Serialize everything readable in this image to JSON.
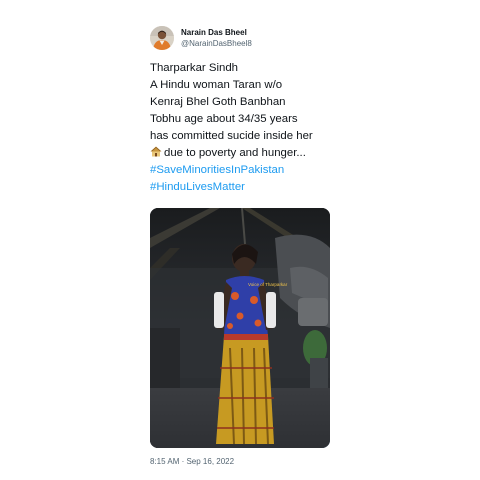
{
  "author": {
    "display_name": "Narain Das Bheel",
    "handle": "@NarainDasBheel8",
    "avatar_icon": "profile-photo-avatar"
  },
  "tweet": {
    "lines": [
      "Tharparkar Sindh",
      "A Hindu woman Taran w/o",
      "Kenraj Bhel Goth Banbhan",
      "Tobhu age about 34/35 years",
      "has committed sucide inside her"
    ],
    "emoji_line_text": "due to poverty and hunger...",
    "emoji_icon": "hut-icon",
    "hashtags": [
      "#SaveMinoritiesInPakistan",
      "#HinduLivesMatter"
    ]
  },
  "media": {
    "watermark": "Voice of Tharparkar"
  },
  "timestamp": "8:15 AM · Sep 16, 2022",
  "colors": {
    "hashtag": "#1d9bf0",
    "text": "#0f1419",
    "secondary": "#536471"
  }
}
